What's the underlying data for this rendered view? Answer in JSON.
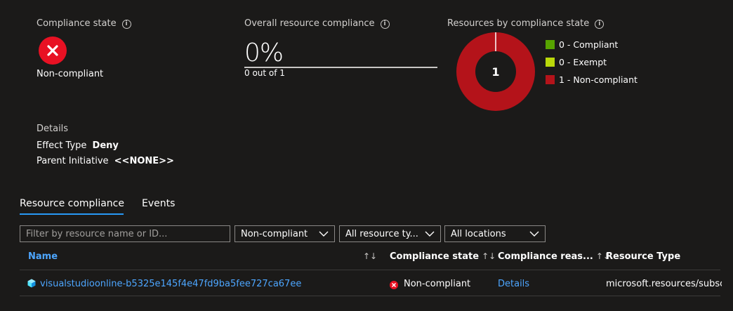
{
  "compliance_state": {
    "title": "Compliance state",
    "value": "Non-compliant"
  },
  "overall": {
    "title": "Overall resource compliance",
    "percent": "0%",
    "progress_fraction": 0,
    "detail": "0 out of 1"
  },
  "resources_by_state": {
    "title": "Resources by compliance state",
    "center_value": "1",
    "legend": [
      {
        "label": "0 - Compliant",
        "color": "#57a300"
      },
      {
        "label": "0 - Exempt",
        "color": "#bad80a"
      },
      {
        "label": "1 - Non-compliant",
        "color": "#b4131a"
      }
    ]
  },
  "chart_data": {
    "type": "pie",
    "categories": [
      "Compliant",
      "Exempt",
      "Non-compliant"
    ],
    "values": [
      0,
      0,
      1
    ]
  },
  "details": {
    "heading": "Details",
    "effect_type_label": "Effect Type",
    "effect_type_value": "Deny",
    "parent_initiative_label": "Parent Initiative",
    "parent_initiative_value": "<<NONE>>"
  },
  "tabs": [
    {
      "label": "Resource compliance",
      "active": true
    },
    {
      "label": "Events",
      "active": false
    }
  ],
  "filters": {
    "search_placeholder": "Filter by resource name or ID...",
    "compliance_filter": "Non-compliant",
    "resource_type_filter": "All resource ty...",
    "locations_filter": "All locations"
  },
  "table": {
    "columns": [
      "Name",
      "Compliance state",
      "Compliance reas...",
      "Resource Type"
    ],
    "rows": [
      {
        "name": "visualstudioonline-b5325e145f4e47fd9ba5fee727ca67ee",
        "state": "Non-compliant",
        "reason": "Details",
        "resource_type": "microsoft.resources/subsc"
      }
    ]
  },
  "colors": {
    "accent": "#2899f5",
    "link": "#4da6ff",
    "error": "#e81123",
    "background": "#1b1a19"
  }
}
